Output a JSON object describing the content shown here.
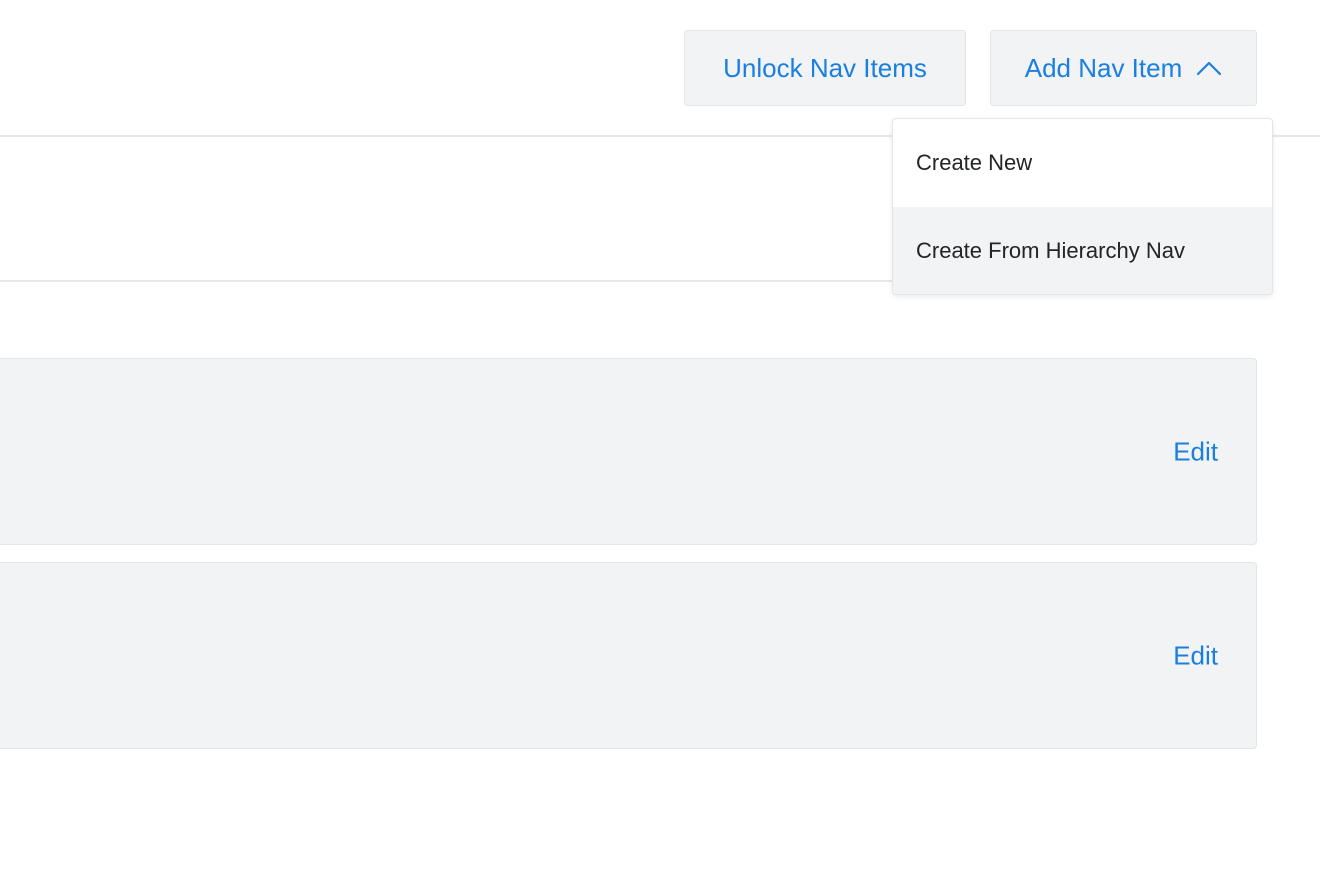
{
  "toolbar": {
    "unlock_label": "Unlock Nav Items",
    "add_label": "Add Nav Item",
    "add_icon": "chevron-up-icon"
  },
  "add_menu": {
    "items": [
      {
        "label": "Create New",
        "hovered": false
      },
      {
        "label": "Create From Hierarchy Nav",
        "hovered": true
      }
    ]
  },
  "nav_items": [
    {
      "action_label": "Edit"
    },
    {
      "action_label": "Edit"
    }
  ],
  "colors": {
    "accent": "#1a7fe0",
    "panel": "#f2f3f5",
    "border": "#e3e5e8",
    "text": "#222428"
  }
}
